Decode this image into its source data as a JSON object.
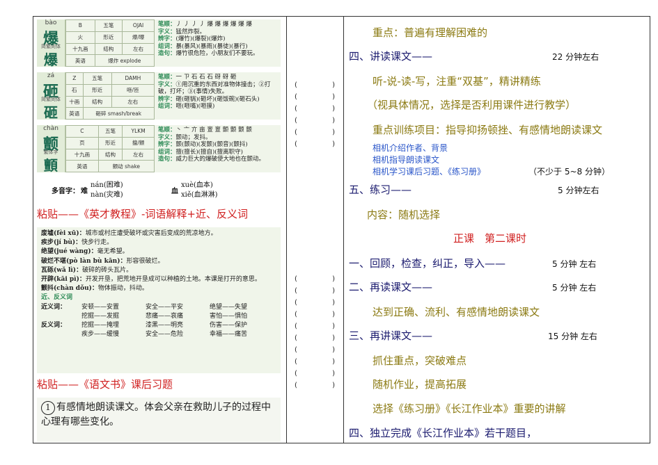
{
  "left": {
    "card1": {
      "pinyin": "bào",
      "char": "爆",
      "trad_label": "简繁同体",
      "trad_char": "爆",
      "grid": [
        [
          "B",
          "五笔",
          "OJAI"
        ],
        [
          "火",
          "形近",
          "爆/曝"
        ],
        [
          "十九画",
          "结构",
          "左右"
        ],
        [
          "英语",
          "爆炸 explode",
          ""
        ]
      ],
      "notes": [
        {
          "k": "笔顺：",
          "v": "丿 丿 丿 丿 爆 爆 爆 爆 爆 爆"
        },
        {
          "k": "字义：",
          "v": "猛然炸裂。"
        },
        {
          "k": "辨字：",
          "v": "(爆竹)(爆裂)(爆炸)"
        },
        {
          "k": "组词：",
          "v": "暴(暴风)(暴雨)(暴徒)(暴行)"
        },
        {
          "k": "造句：",
          "v": "爆竹很危险，小朋友们不要玩。"
        }
      ]
    },
    "card2": {
      "pinyin": "zá",
      "char": "砸",
      "trad_label": "简繁同体",
      "trad_char": "砸",
      "grid": [
        [
          "Z",
          "五笔",
          "DAMH"
        ],
        [
          "石",
          "形近",
          "咂/匝"
        ],
        [
          "十画",
          "结构",
          "左右"
        ],
        [
          "英语",
          "砸碎 smash/break",
          ""
        ]
      ],
      "notes": [
        {
          "k": "笔顺：",
          "v": "一 ㄗ 石 石 石 砑 砑 砸"
        },
        {
          "k": "字义：",
          "v": "①用沉重的东西对准物体撞击；②打破，打坏；③(事情)失败。"
        },
        {
          "k": "辨字：",
          "v": "砸(砸锅)(砸坏)(砸饭碗)(砸石头)"
        },
        {
          "k": "组词：",
          "v": "咂(咂嘴)(咂摸)"
        },
        {
          "k": "造句：",
          "v": "菊秧被倒下的墙砸死了。"
        }
      ]
    },
    "card3": {
      "pinyin": "chàn",
      "char": "颤",
      "trad_label": "繁体字",
      "trad_char": "顫",
      "grid": [
        [
          "C",
          "五笔",
          "YLKM"
        ],
        [
          "页",
          "形近",
          "擅/颤"
        ],
        [
          "十九画",
          "结构",
          "左右"
        ],
        [
          "英语",
          "颤动 shake",
          ""
        ]
      ],
      "notes": [
        {
          "k": "笔顺：",
          "v": "丶 亠 亣 亩 亶 亶 颤 颤 颤 颤"
        },
        {
          "k": "字义：",
          "v": "颤动；发抖。"
        },
        {
          "k": "辨字：",
          "v": "颤(颤动)(发颤)(颤音)(颤抖)"
        },
        {
          "k": "组词：",
          "v": "擅(擅长)(擅自)(擅离职守)"
        },
        {
          "k": "造句：",
          "v": "威力巨大的爆破使大地也在颤动。"
        }
      ]
    },
    "polyphone": {
      "label": "多音字：",
      "c1": "难",
      "c1_r1": "nán(困难)",
      "c1_r2": "nàn(灾难)",
      "c2": "血",
      "c2_r1": "xuè(血本)",
      "c2_r2": "xiě(血淋淋)"
    },
    "paste1": "粘贴——《英才教程》-词语解释+近、反义词",
    "vocab": [
      {
        "w": "废墟(fèi xū)：",
        "d": "城市或村庄遭受破坏或灾害后变成的荒凉地方。"
      },
      {
        "w": "疾步(jí bù)：",
        "d": "快步行走。"
      },
      {
        "w": "绝望(jué wàng)：",
        "d": "毫无希望。"
      },
      {
        "w": "破烂不堪(pò làn bù kān)：",
        "d": "形容很破烂。"
      },
      {
        "w": "瓦砾(wǎ lì)：",
        "d": "破碎的砖头瓦片。"
      },
      {
        "w": "开辟(kāi pì)：",
        "d": "开发开垦，把荒地开垦成可以种植的土地。本课是打开的意思。"
      },
      {
        "w": "颤抖(chàn dǒu)：",
        "d": "物体振动，抖动。"
      }
    ],
    "vocab_section": "近、反义词",
    "synonyms_label": "近义词：",
    "synonyms": [
      [
        "安顿——安置",
        "安全——平安",
        "绝望——失望"
      ],
      [
        "挖掘——发掘",
        "悲痛——哀痛",
        "害怕——惧怕"
      ]
    ],
    "antonyms_label": "反义词：",
    "antonyms": [
      [
        "挖掘——掩埋",
        "漆黑——明亮",
        "伤害——保护"
      ],
      [
        "疾步——缓慢",
        "安全——危险",
        "幸福——痛苦"
      ]
    ],
    "paste2": "粘贴——《语文书》课后习题",
    "exercise_num": "1",
    "exercise_text": "有感情地朗读课文。体会父亲在救助儿子的过程中心理有哪些变化。"
  },
  "mid": {
    "open": "(",
    "close": ")"
  },
  "right": {
    "key_point": "重点：普遍有理解困难的",
    "s4_title": "四、讲读课文——",
    "s4_time": "22 分钟左右",
    "s4_line1": "听-说-读-写，注重“双基”，精讲精练",
    "s4_line2": "（视具体情况，选择是否利用课件进行教学）",
    "s4_line3": "重点训练项目：指导抑扬顿挫、有感情地朗读课文",
    "blue1": "相机介绍作者、背景",
    "blue2": "相机指导朗读课文",
    "blue3": "相机学习课后习题、《练习册》",
    "blue3_note": "（不少于 5~8 分钟）",
    "s5_title": "五、练习——",
    "s5_time": "5 分钟左右",
    "s5_content": "内容：随机选择",
    "lesson2": "正课　第二课时",
    "p1_title": "一、回顾，检查，纠正，导入——",
    "p1_time": "5 分钟  左右",
    "p2_title": "二、再读课文——",
    "p2_time": "5 分钟  左右",
    "p2_content": "达到正确、流利、有感情地朗读课文",
    "p3_title": "三、再讲课文——",
    "p3_time": "15 分钟  左右",
    "p3_c1": "抓住重点，突破难点",
    "p3_c2": "随机作业，提高拓展",
    "p3_c3": "选择《练习册》《长江作业本》重要的讲解",
    "p4_title": "四、独立完成《长江作业本》若干题目，"
  }
}
